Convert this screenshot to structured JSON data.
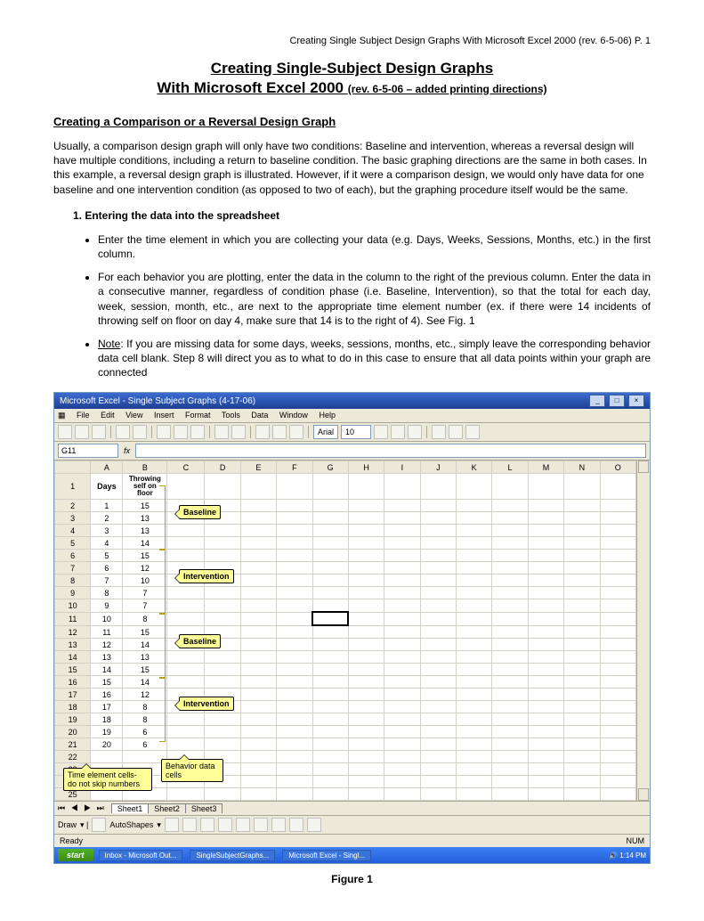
{
  "header_right": "Creating Single Subject Design Graphs With Microsoft Excel 2000 (rev. 6-5-06) P. 1",
  "title_line1": "Creating Single-Subject Design Graphs",
  "title_line2_main": "With Microsoft Excel 2000 ",
  "title_line2_rev": "(rev. 6-5-06 – added printing directions)",
  "section_heading": "Creating a Comparison or a Reversal Design Graph",
  "intro_para": "Usually, a comparison design graph will only have two conditions:  Baseline and intervention, whereas a reversal design will have multiple conditions, including a return to baseline condition.  The basic graphing directions are the same in both cases.  In this example, a reversal design graph is illustrated.  However, if it were a comparison design, we would only have data for one baseline and one intervention condition (as opposed to two of each), but the graphing procedure itself would be the same.",
  "step1_label": "1.    Entering the data into the spreadsheet",
  "bullets": [
    "Enter the time element in which you are collecting your data (e.g. Days, Weeks, Sessions, Months, etc.) in the first column.",
    "For each behavior you are plotting, enter the data in the column to the right of the previous column.  Enter the data in a consecutive manner, regardless of condition phase (i.e. Baseline, Intervention), so that the total for each day, week, session, month, etc., are next to the appropriate time element number (ex. if there were 14 incidents of throwing self on floor on day 4, make sure that 14 is to the right of 4).  See Fig. 1"
  ],
  "note_prefix": "Note",
  "note_text": ":  If you are missing data for some days, weeks, sessions, months, etc., simply leave the corresponding behavior data cell blank.  Step 8 will direct you as to what to do in this case to ensure that all data points within your graph are connected",
  "excel": {
    "title": "Microsoft Excel - Single Subject Graphs (4-17-06)",
    "menus": [
      "File",
      "Edit",
      "View",
      "Insert",
      "Format",
      "Tools",
      "Data",
      "Window",
      "Help"
    ],
    "font_name": "Arial",
    "font_size": "10",
    "namebox": "G11",
    "columns": [
      "A",
      "B",
      "C",
      "D",
      "E",
      "F",
      "G",
      "H",
      "I",
      "J",
      "K",
      "L",
      "M",
      "N",
      "O"
    ],
    "header_row": {
      "a": "Days",
      "b": "Throwing self on floor"
    },
    "rows": [
      {
        "r": "1"
      },
      {
        "r": "2",
        "a": "1",
        "b": "15"
      },
      {
        "r": "3",
        "a": "2",
        "b": "13"
      },
      {
        "r": "4",
        "a": "3",
        "b": "13"
      },
      {
        "r": "5",
        "a": "4",
        "b": "14"
      },
      {
        "r": "6",
        "a": "5",
        "b": "15"
      },
      {
        "r": "7",
        "a": "6",
        "b": "12"
      },
      {
        "r": "8",
        "a": "7",
        "b": "10"
      },
      {
        "r": "9",
        "a": "8",
        "b": "7"
      },
      {
        "r": "10",
        "a": "9",
        "b": "7"
      },
      {
        "r": "11",
        "a": "10",
        "b": "8"
      },
      {
        "r": "12",
        "a": "11",
        "b": "15"
      },
      {
        "r": "13",
        "a": "12",
        "b": "14"
      },
      {
        "r": "14",
        "a": "13",
        "b": "13"
      },
      {
        "r": "15",
        "a": "14",
        "b": "15"
      },
      {
        "r": "16",
        "a": "15",
        "b": "14"
      },
      {
        "r": "17",
        "a": "16",
        "b": "12"
      },
      {
        "r": "18",
        "a": "17",
        "b": "8"
      },
      {
        "r": "19",
        "a": "18",
        "b": "8"
      },
      {
        "r": "20",
        "a": "19",
        "b": "6"
      },
      {
        "r": "21",
        "a": "20",
        "b": "6"
      },
      {
        "r": "22"
      },
      {
        "r": "23"
      },
      {
        "r": "24"
      },
      {
        "r": "25"
      }
    ],
    "callouts": {
      "baseline1": "Baseline",
      "intervention1": "Intervention",
      "baseline2": "Baseline",
      "intervention2": "Intervention",
      "time_element": "Time element cells- do not skip numbers",
      "behavior_cells": "Behavior data cells"
    },
    "sheets": [
      "Sheet1",
      "Sheet2",
      "Sheet3"
    ],
    "draw_label": "Draw",
    "autoshapes_label": "AutoShapes",
    "status_left": "Ready",
    "status_right": "NUM",
    "start": "start",
    "task_items": [
      "Inbox - Microsoft Out...",
      "SingleSubjectGraphs...",
      "Microsoft Excel - Singl..."
    ],
    "clock": "1:14 PM"
  },
  "figure_caption": "Figure 1"
}
